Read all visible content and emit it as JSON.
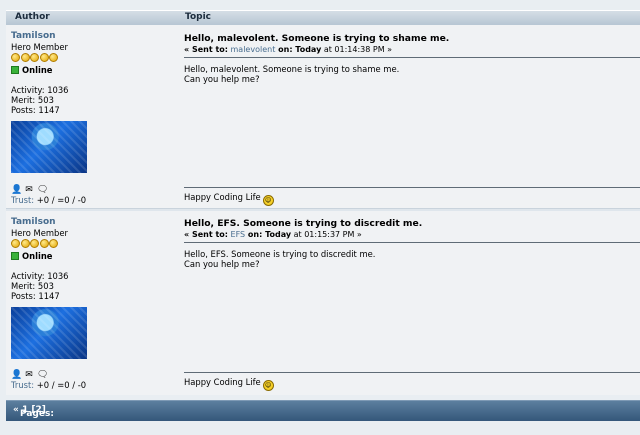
{
  "table_header": {
    "author": "Author",
    "topic": "Topic"
  },
  "posts": [
    {
      "author": {
        "name": "Tamilson",
        "rank": "Hero Member",
        "status": "Online",
        "activity": "Activity: 1036",
        "merit": "Merit: 503",
        "posts": "Posts: 1147",
        "trust_label": "Trust:",
        "trust_value": " +0 / =0 / -0"
      },
      "subject": "Hello, malevolent. Someone is trying to shame me.",
      "sent_prefix": "« Sent to:",
      "recipient": "malevolent",
      "sent_on": " on: Today",
      "sent_time": " at 01:14:38 PM »",
      "body": [
        "Hello, malevolent. Someone is trying to shame me.",
        "Can you help me?"
      ],
      "signature": "Happy Coding Life"
    },
    {
      "author": {
        "name": "Tamilson",
        "rank": "Hero Member",
        "status": "Online",
        "activity": "Activity: 1036",
        "merit": "Merit: 503",
        "posts": "Posts: 1147",
        "trust_label": "Trust:",
        "trust_value": " +0 / =0 / -0"
      },
      "subject": "Hello, EFS. Someone is trying to discredit me.",
      "sent_prefix": "« Sent to:",
      "recipient": "EFS",
      "sent_on": " on: Today",
      "sent_time": " at 01:15:37 PM »",
      "body": [
        "Hello, EFS. Someone is trying to discredit me.",
        "Can you help me?"
      ],
      "signature": "Happy Coding Life"
    }
  ],
  "pagination": {
    "label": "Pages:",
    "prev": "«",
    "current": "1",
    "next_link": "[2]"
  },
  "colors": {
    "link": "#476c8e",
    "pagination_bar": "#34577a",
    "online": "#3ab23a"
  }
}
